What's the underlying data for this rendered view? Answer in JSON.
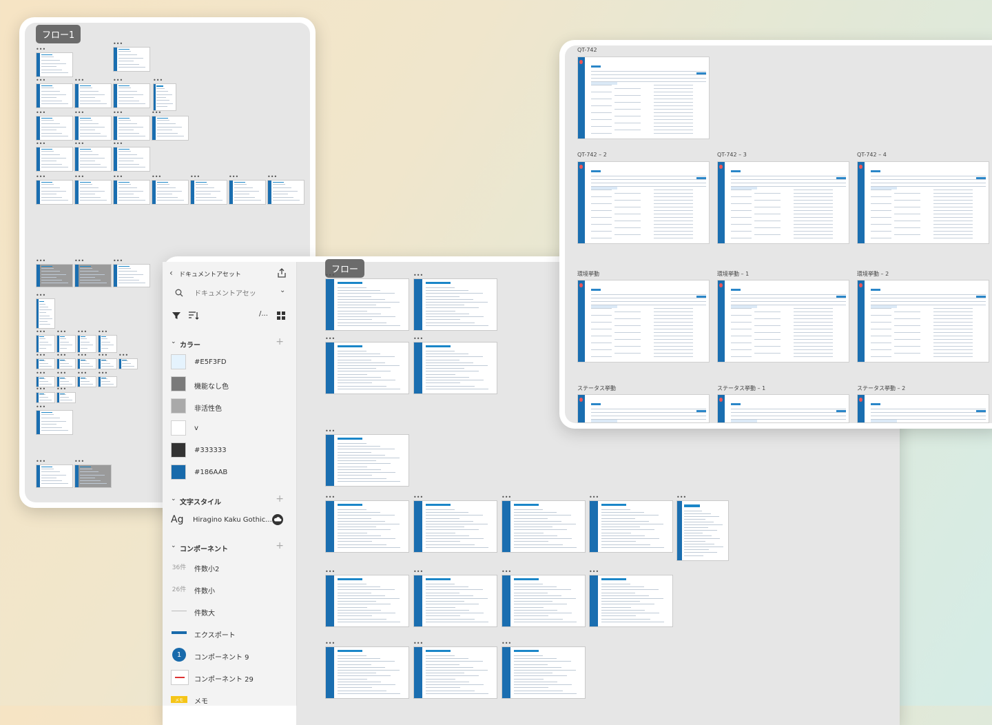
{
  "flow1": {
    "title": "フロー1"
  },
  "flow2": {
    "title": "フロー"
  },
  "main_panel": {
    "labels": [
      "QT-742",
      "QT-742 – 2",
      "QT-742 – 3",
      "QT-742 – 4",
      "環境挙動",
      "環境挙動 – 1",
      "環境挙動 – 2",
      "ステータス挙動",
      "ステータス挙動 – 1",
      "ステータス挙動 – 2"
    ]
  },
  "assets": {
    "back_label": "ドキュメントアセット",
    "search_placeholder": "ドキュメントアセッ",
    "colors_title": "カラー",
    "colors": [
      {
        "name": "#E5F3FD",
        "hex": "#E5F3FD"
      },
      {
        "name": "機能なし色",
        "hex": "#7A7A7A"
      },
      {
        "name": "非活性色",
        "hex": "#A9A9A9"
      },
      {
        "name": "v",
        "hex": "#FFFFFF"
      },
      {
        "name": "#333333",
        "hex": "#333333"
      },
      {
        "name": "#186AAB",
        "hex": "#186AAB"
      }
    ],
    "text_styles_title": "文字スタイル",
    "text_style_sample": "Ag",
    "text_style_name": "Hiragino Kaku Gothic...",
    "components_title": "コンポーネント",
    "components": [
      {
        "icon_text": "36件",
        "name": "件数小2"
      },
      {
        "icon_text": "26件",
        "name": "件数小"
      },
      {
        "icon_text": "",
        "name": "件数大"
      },
      {
        "icon_text": "",
        "name": "エクスポート"
      },
      {
        "icon_text": "1",
        "name": "コンポーネント 9"
      },
      {
        "icon_text": "",
        "name": "コンポーネント 29"
      },
      {
        "icon_text": "メモ",
        "name": "メモ"
      }
    ]
  },
  "colors": {
    "accent": "#186AAB",
    "canvas": "#E6E6E6"
  }
}
